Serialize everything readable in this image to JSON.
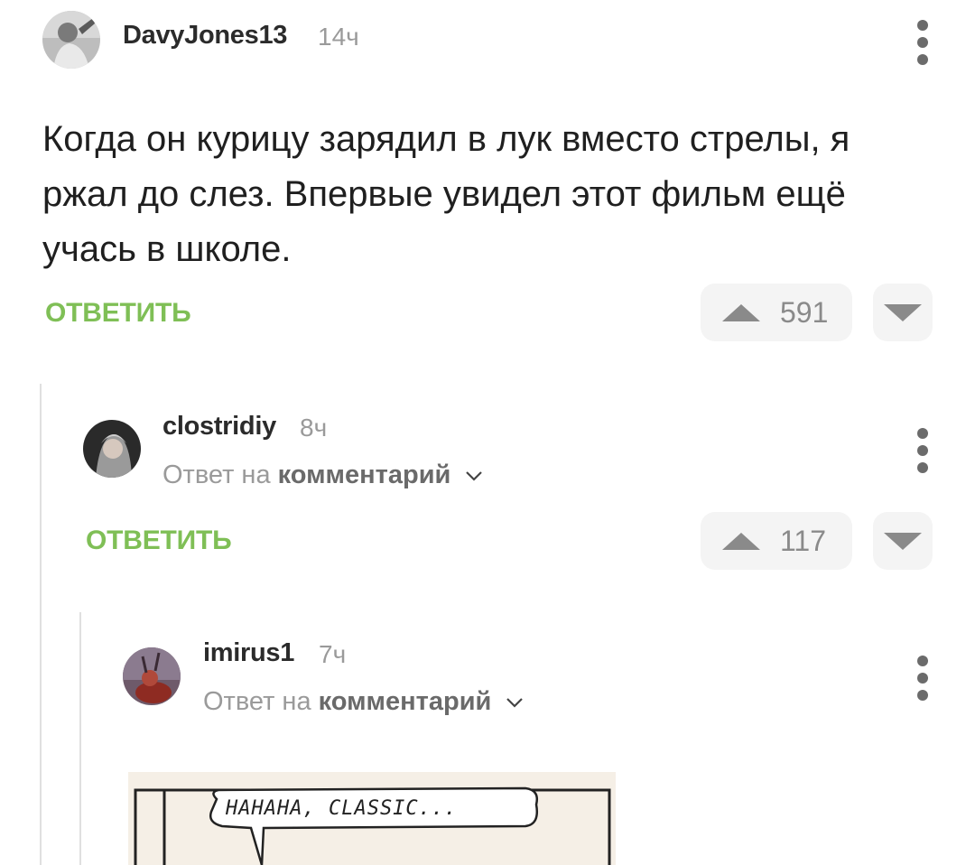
{
  "comments": [
    {
      "username": "DavyJones13",
      "time": "14ч",
      "text": "Когда он курицу зарядил в лук вместо стрелы, я ржал до слез. Впервые увидел этот фильм ещё учась в школе.",
      "reply_label": "ОТВЕТИТЬ",
      "votes": "591"
    },
    {
      "username": "clostridiy",
      "time": "8ч",
      "reply_prefix": "Ответ на",
      "reply_target": "комментарий",
      "reply_label": "ОТВЕТИТЬ",
      "votes": "117"
    },
    {
      "username": "imirus1",
      "time": "7ч",
      "reply_prefix": "Ответ на",
      "reply_target": "комментарий",
      "image_text": "HAHAHA, CLASSIC..."
    }
  ],
  "colors": {
    "accent": "#7fbf56",
    "muted": "#9a9a9a",
    "vote_bg": "#f4f4f4"
  }
}
